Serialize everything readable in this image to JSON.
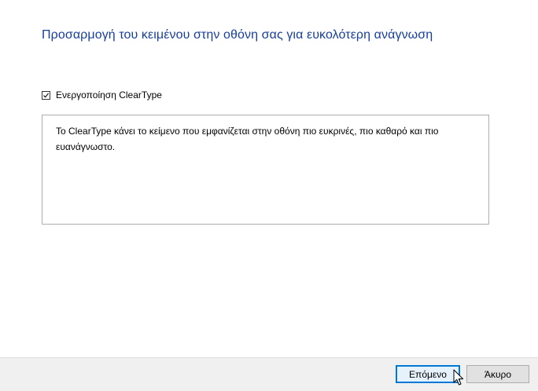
{
  "page": {
    "title": "Προσαρμογή του κειμένου στην οθόνη σας για ευκολότερη ανάγνωση"
  },
  "cleartype": {
    "label": "Ενεργοποίηση ClearType",
    "checked": true
  },
  "description": {
    "text": "Το ClearType κάνει το κείμενο που εμφανίζεται στην οθόνη πιο ευκρινές, πιο καθαρό και πιο ευανάγνωστο."
  },
  "footer": {
    "next_label": "Επόμενο",
    "cancel_label": "Άκυρο"
  },
  "colors": {
    "title": "#173e9c",
    "footer_bg": "#f0f0f0",
    "default_button_border": "#0078d7"
  },
  "icons": {
    "checkbox": "check-icon",
    "pointer": "mouse-pointer-icon"
  }
}
